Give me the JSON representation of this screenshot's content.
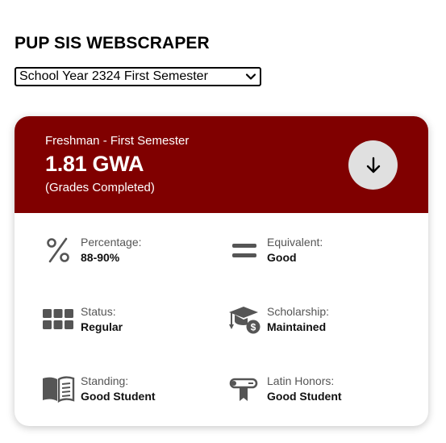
{
  "app": {
    "title": "PUP SIS WEBSCRAPER"
  },
  "semester_select": {
    "selected": "School Year 2324 First Semester"
  },
  "card": {
    "term": "Freshman - First Semester",
    "gwa": "1.81 GWA",
    "gwa_note": "(Grades Completed)",
    "header_color": "#800000"
  },
  "stats": {
    "percentage": {
      "label": "Percentage:",
      "value": "88-90%",
      "icon": "percent-icon"
    },
    "equivalent": {
      "label": "Equivalent:",
      "value": "Good",
      "icon": "equals-icon"
    },
    "status": {
      "label": "Status:",
      "value": "Regular",
      "icon": "grid-icon"
    },
    "scholarship": {
      "label": "Scholarship:",
      "value": "Maintained",
      "icon": "graduation-cap-money-icon"
    },
    "standing": {
      "label": "Standing:",
      "value": "Good Student",
      "icon": "open-book-icon"
    },
    "latin_honors": {
      "label": "Latin Honors:",
      "value": "Good Student",
      "icon": "diploma-scroll-icon"
    }
  }
}
